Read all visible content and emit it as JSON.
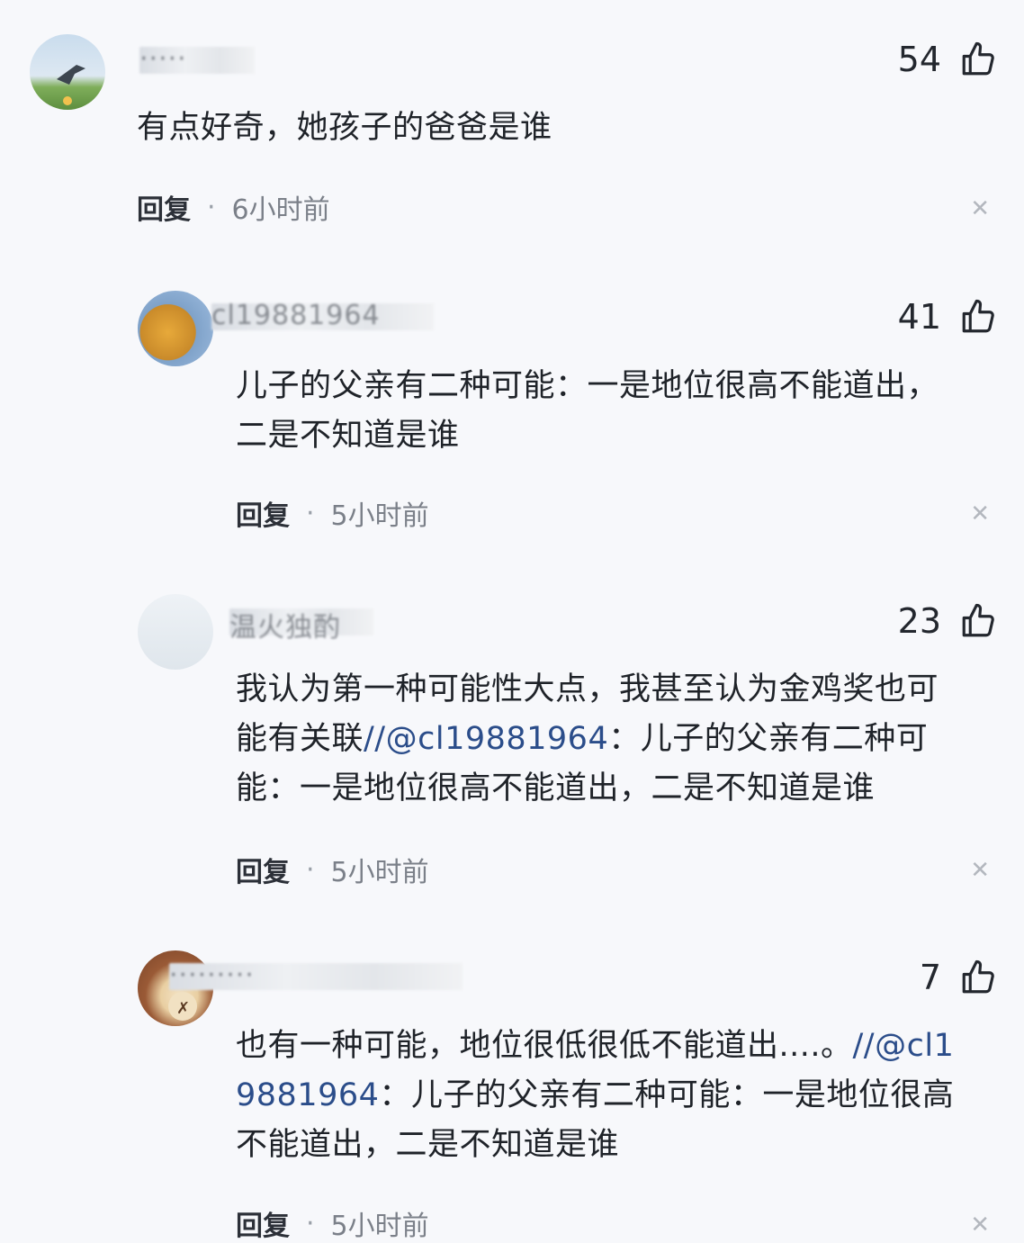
{
  "comments": [
    {
      "username": "·····",
      "likes": "54",
      "text": "有点好奇，她孩子的爸爸是谁",
      "reply_label": "回复",
      "time": "6小时前"
    },
    {
      "username": "cl19881964",
      "likes": "41",
      "text_line1": "儿子的父亲有二种可能：一是地位很高不能道出，",
      "text_line2": "二是不知道是谁",
      "reply_label": "回复",
      "time": "5小时前"
    },
    {
      "username": "温火独酌",
      "likes": "23",
      "text_line1": "我认为第一种可能性大点，我甚至认为金鸡奖也可",
      "text_line2_a": "能有关联",
      "text_line2_mention": "//@cl19881964",
      "text_line2_b": "：儿子的父亲有二种可",
      "text_line3": "能：一是地位很高不能道出，二是不知道是谁",
      "reply_label": "回复",
      "time": "5小时前"
    },
    {
      "username": "·········",
      "likes": "7",
      "text_line1_a": "也有一种可能，地位很低很低不能道出....。",
      "text_line1_mention": "//@cl1",
      "text_line2_mention": "9881964",
      "text_line2_b": "：儿子的父亲有二种可能：一是地位很高",
      "text_line3": "不能道出，二是不知道是谁",
      "reply_label": "回复",
      "time": "5小时前"
    }
  ]
}
